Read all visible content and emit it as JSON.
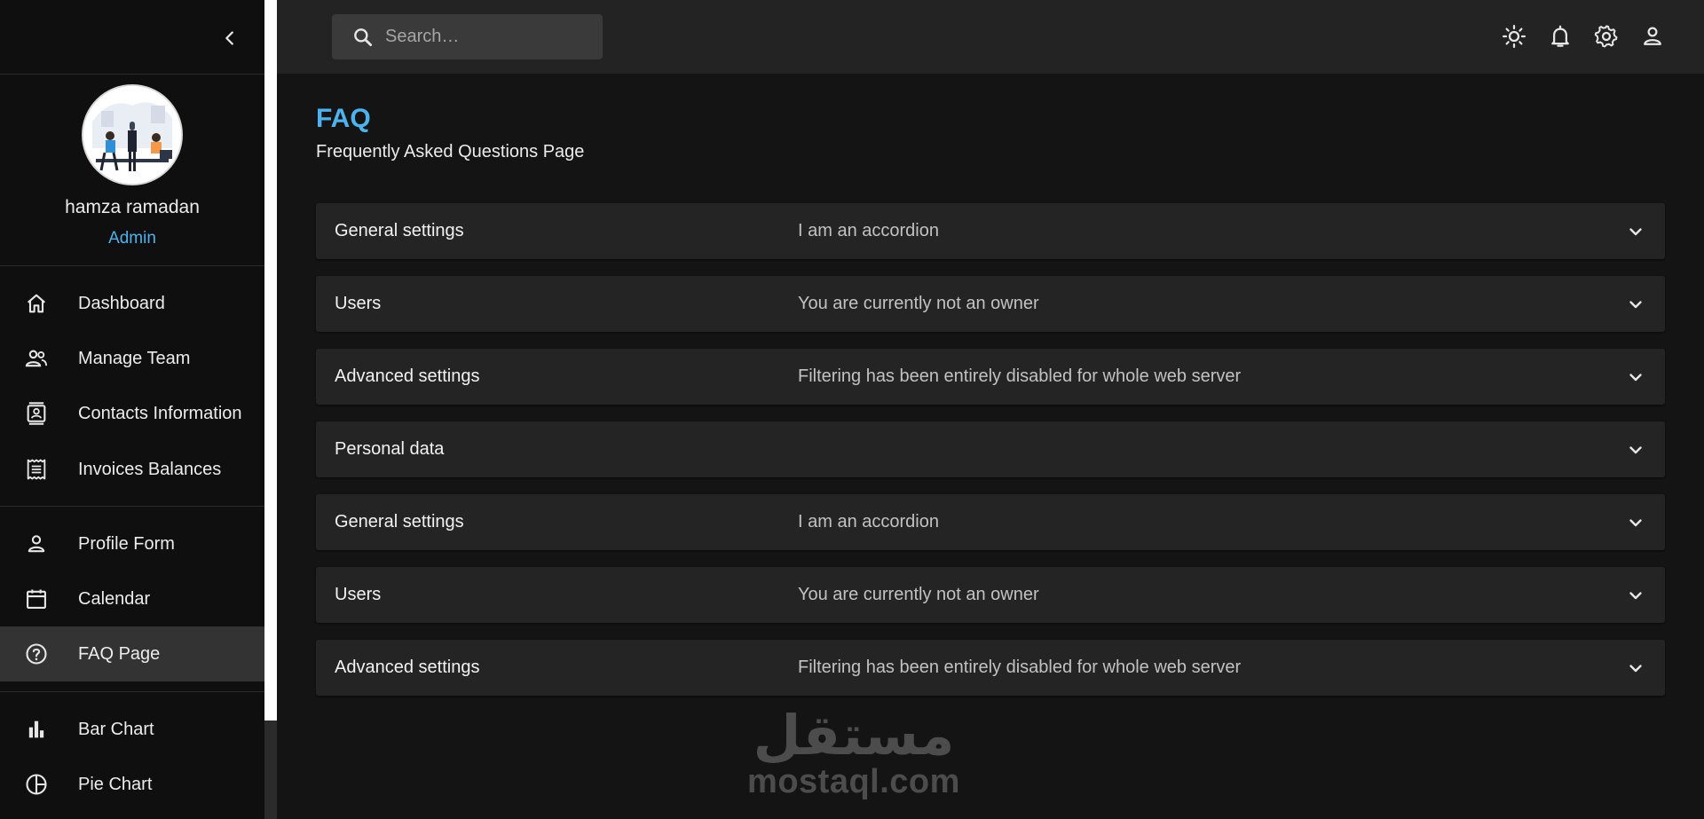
{
  "sidebar": {
    "user": {
      "name": "hamza ramadan",
      "role": "Admin"
    },
    "items": [
      {
        "label": "Dashboard",
        "icon": "home-icon"
      },
      {
        "label": "Manage Team",
        "icon": "people-icon"
      },
      {
        "label": "Contacts Information",
        "icon": "contacts-icon"
      },
      {
        "label": "Invoices Balances",
        "icon": "receipt-icon"
      },
      {
        "label": "Profile Form",
        "icon": "person-icon"
      },
      {
        "label": "Calendar",
        "icon": "calendar-icon"
      },
      {
        "label": "FAQ Page",
        "icon": "help-circle-icon",
        "active": true
      },
      {
        "label": "Bar Chart",
        "icon": "bar-chart-icon"
      },
      {
        "label": "Pie Chart",
        "icon": "pie-chart-icon"
      }
    ]
  },
  "topbar": {
    "search_placeholder": "Search…",
    "icons": [
      "light-mode-icon",
      "notifications-icon",
      "settings-icon",
      "account-icon"
    ]
  },
  "page": {
    "title": "FAQ",
    "subtitle": "Frequently Asked Questions Page"
  },
  "faq": [
    {
      "title": "General settings",
      "summary": "I am an accordion"
    },
    {
      "title": "Users",
      "summary": "You are currently not an owner"
    },
    {
      "title": "Advanced settings",
      "summary": "Filtering has been entirely disabled for whole web server"
    },
    {
      "title": "Personal data",
      "summary": ""
    },
    {
      "title": "General settings",
      "summary": "I am an accordion"
    },
    {
      "title": "Users",
      "summary": "You are currently not an owner"
    },
    {
      "title": "Advanced settings",
      "summary": "Filtering has been entirely disabled for whole web server"
    }
  ],
  "watermark": {
    "arabic": "مستقل",
    "latin": "mostaql.com"
  },
  "colors": {
    "accent": "#4cb3ee",
    "sidebar_bg": "#0f0f0f",
    "topbar_bg": "#232323",
    "main_bg": "#141414",
    "accordion_bg": "#242424",
    "active_nav_bg": "#333333"
  }
}
